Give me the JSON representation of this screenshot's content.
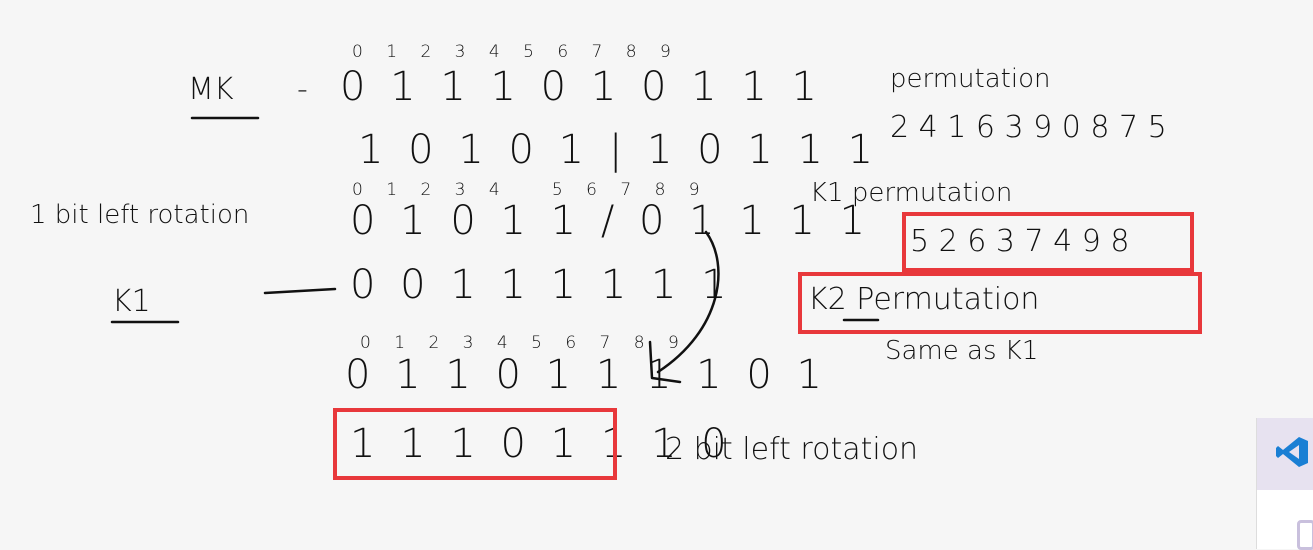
{
  "mk": {
    "label": "MK",
    "dash": "-",
    "indices": "0 1 2 3 4 5 6 7 8 9",
    "bits": "0 1 1 1 0 1 0 1 1 1"
  },
  "permuted": {
    "bits": "1 0 1 0 1 | 1 0 1 1 1"
  },
  "rotated": {
    "indices": "0 1 2 3 4   5 6 7 8 9",
    "label": "1 bit left rotation",
    "bits": "0 1 0 1 1 / 0 1 1 1 1"
  },
  "k1": {
    "label": "K1",
    "bits": "0 0 1 1 1 1 1 1"
  },
  "rotated2": {
    "indices": "0 1 2 3 4 5 6 7 8 9",
    "bits": "0 1 1 0 1 1 1 1 0 1"
  },
  "k2": {
    "bits": "1 1 1 0 1 1 1 0",
    "label": "2 bit left rotation"
  },
  "right": {
    "permutation_title": "permutation",
    "permutation_values": "2 4 1 6 3 9 0 8 7 5",
    "k1_title": "K1 permutation",
    "k1_values": "5 2 6 3 7 4 9 8",
    "k2_title": "K2 Permutation",
    "k2_note": "Same as K1"
  },
  "highlight_color": "#e8383b",
  "taskbar": {
    "icon": "vscode-icon"
  }
}
